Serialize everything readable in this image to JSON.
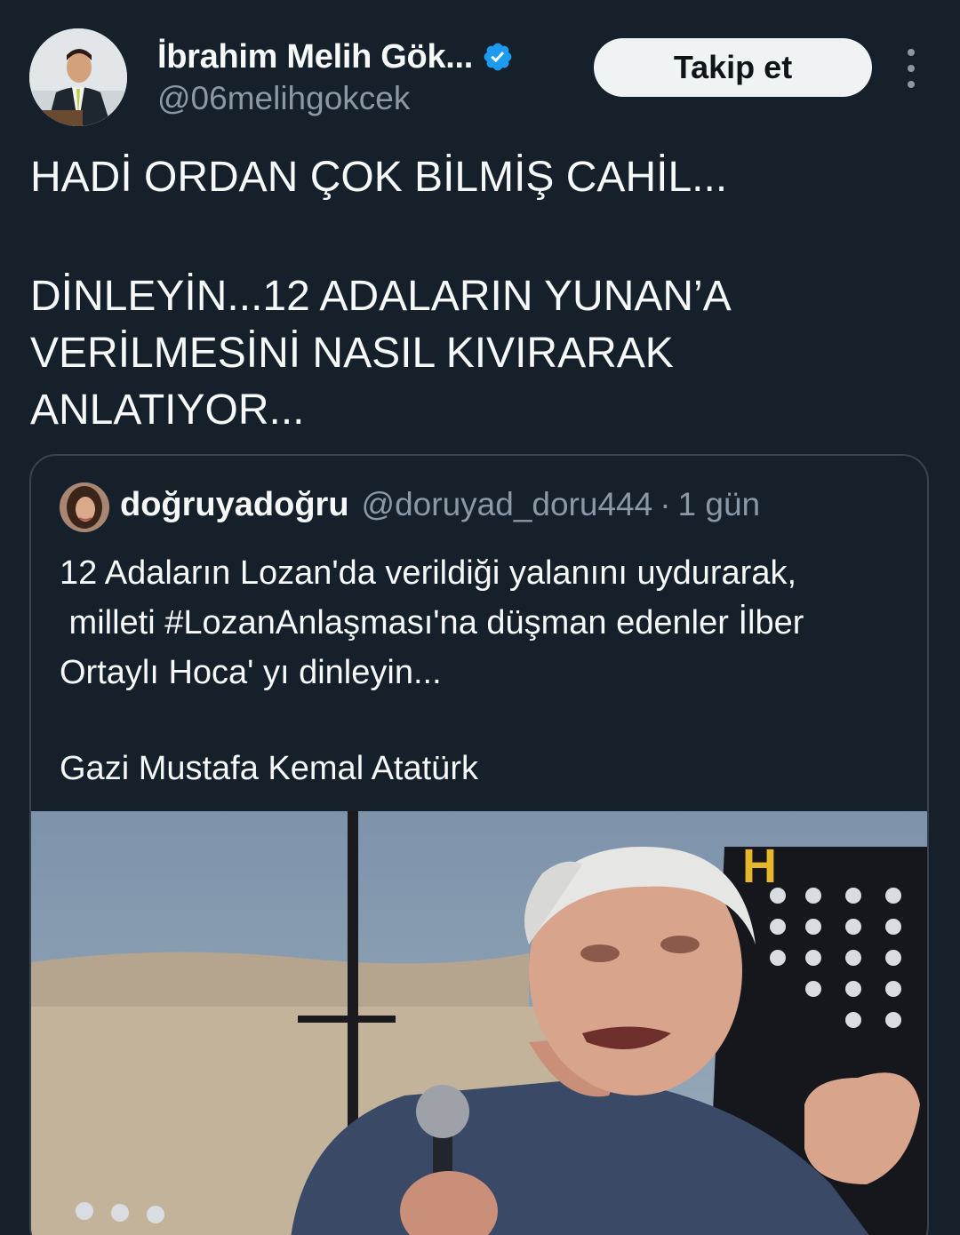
{
  "author": {
    "display_name": "İbrahim Melih Gök...",
    "handle": "@06melihgokcek",
    "verified": true,
    "avatar_icon": "profile-photo"
  },
  "actions": {
    "follow_label": "Takip et",
    "more_icon": "more-vertical-icon"
  },
  "tweet": {
    "lines": [
      "HADİ ORDAN ÇOK BİLMİŞ CAHİL...",
      "DİNLEYİN...12 ADALARIN YUNAN’A",
      "VERİLMESİNİ NASIL KIVIRARAK",
      "ANLATIYOR..."
    ]
  },
  "quoted": {
    "display_name": "doğruyadoğru",
    "handle": "@doruyad_doru444",
    "separator": "·",
    "time": "1 gün",
    "lines": [
      "12 Adaların Lozan'da verildiği yalanını uydurarak,",
      " milleti #LozanAnlaşması'na düşman edenler İlber",
      "Ortaylı Hoca' yı dinleyin...",
      "Gazi Mustafa Kemal Atatürk"
    ],
    "media": {
      "type": "video-thumbnail",
      "overlay_text": "H"
    }
  },
  "colors": {
    "background": "#15202b",
    "text_primary": "#f7f9f9",
    "text_secondary": "#8b98a5",
    "verified_blue": "#1d9bf0",
    "border": "#38444d",
    "button_bg": "#eff3f4"
  }
}
